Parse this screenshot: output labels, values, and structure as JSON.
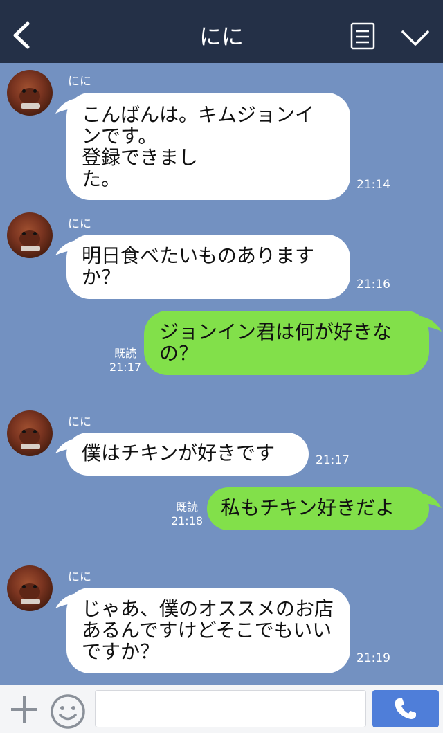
{
  "header": {
    "title": "にに"
  },
  "messages": [
    {
      "sender": "にに",
      "lines": [
        "こんばんは。キムジョンイ",
        "ンです。",
        "登録できまし",
        "た。"
      ],
      "time": "21:14"
    },
    {
      "sender": "にに",
      "lines": [
        "明日食べたいものありますか？"
      ],
      "time": "21:16"
    },
    {
      "read": "既読",
      "lines": [
        "ジョンイン君は何が好きなの？"
      ],
      "time": "21:17"
    },
    {
      "sender": "にに",
      "lines": [
        "僕はチキンが好きです"
      ],
      "time": "21:17"
    },
    {
      "read": "既読",
      "lines": [
        "私もチキン好きだよ"
      ],
      "time": "21:18"
    },
    {
      "sender": "にに",
      "lines": [
        "じゃあ、僕のオススメのお店あるんですけどそこでもいいですか？"
      ],
      "time": "21:19"
    }
  ],
  "input": {
    "value": ""
  },
  "icons": {
    "back": "chevron-left-icon",
    "notes": "notes-icon",
    "menu": "chevron-down-icon",
    "add": "plus-icon",
    "emoji": "smiley-icon",
    "call": "phone-icon"
  },
  "colors": {
    "header_bg": "#243047",
    "chat_bg": "#7391c1",
    "incoming_bubble": "#ffffff",
    "outgoing_bubble": "#82e04a",
    "call_button": "#4f7ed9"
  }
}
